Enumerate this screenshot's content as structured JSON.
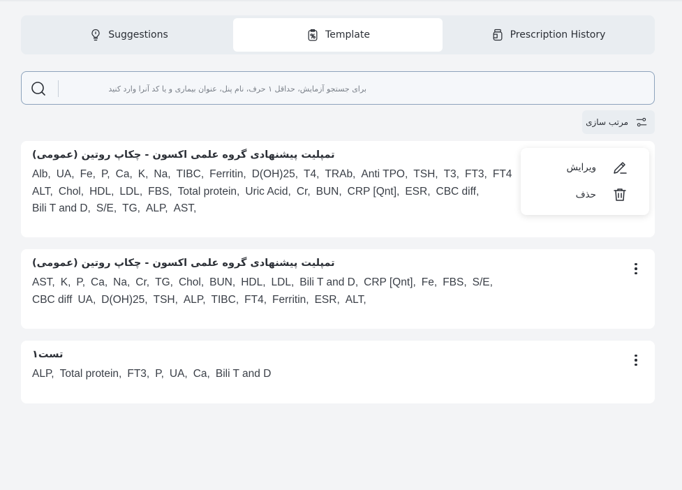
{
  "tabs": [
    {
      "label": "Suggestions",
      "icon": "lightbulb-icon",
      "active": false
    },
    {
      "label": "Template",
      "icon": "template-icon",
      "active": true
    },
    {
      "label": "Prescription History",
      "icon": "medicine-bottle-icon",
      "active": false
    }
  ],
  "search": {
    "placeholder": "برای جستجو آزمایش، حداقل ۱ حرف، نام پنل، عنوان بیماری و یا کد آنرا وارد کنید",
    "value": ""
  },
  "sort": {
    "label": "مرتب سازی"
  },
  "templates": [
    {
      "title": "تمپلیت پیشنهادی گروه علمی اکسون - چکاپ روتین (عمومی)",
      "items": [
        "Alb,",
        "UA,",
        "Fe,",
        "P,",
        "Ca,",
        "K,",
        "Na,",
        "TIBC,",
        "Ferritin,",
        "D(OH)25,",
        "T4,",
        "TRAb,",
        "Anti TPO,",
        "TSH,",
        "T3,",
        "FT3,",
        "FT4",
        "ALT,",
        "Chol,",
        "HDL,",
        "LDL,",
        "FBS,",
        "Total protein,",
        "Uric Acid,",
        "Cr,",
        "BUN,",
        "CRP [Qnt],",
        "ESR,",
        "CBC diff,",
        "Bili T and D,",
        "S/E,",
        "TG,",
        "ALP,",
        "AST,"
      ]
    },
    {
      "title": "تمپلیت پیشنهادی گروه علمی اکسون - چکاپ روتین (عمومی)",
      "items": [
        "AST,",
        "K,",
        "P,",
        "Ca,",
        "Na,",
        "Cr,",
        "TG,",
        "Chol,",
        "BUN,",
        "HDL,",
        "LDL,",
        "Bili T and D,",
        "CRP [Qnt],",
        "Fe,",
        "FBS,",
        "S/E,",
        "CBC diff",
        "UA,",
        "D(OH)25,",
        "TSH,",
        "ALP,",
        "TIBC,",
        "FT4,",
        "Ferritin,",
        "ESR,",
        "ALT,"
      ]
    },
    {
      "title": "تست۱",
      "items": [
        "ALP,",
        "Total protein,",
        "FT3,",
        "P,",
        "UA,",
        "Ca,",
        "Bili T and D"
      ]
    }
  ],
  "context_menu": {
    "edit_label": "ویرایش",
    "delete_label": "حذف"
  }
}
